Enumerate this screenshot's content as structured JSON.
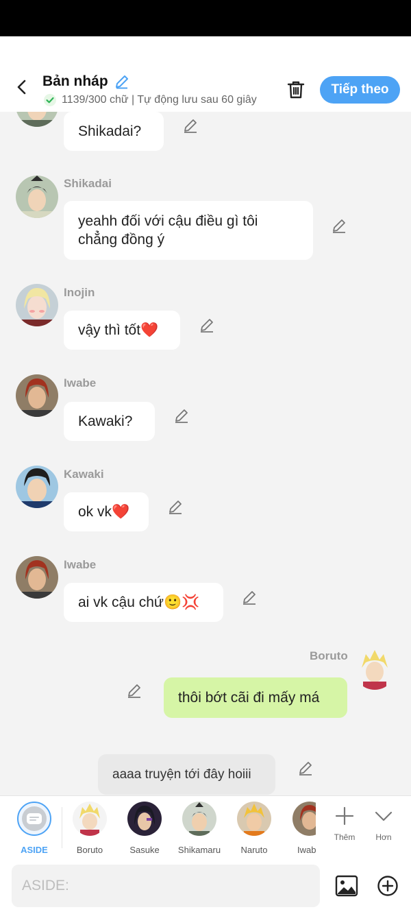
{
  "header": {
    "title": "Bản nháp",
    "status": "1139/300 chữ | Tự động lưu sau 60 giây",
    "next_label": "Tiếp theo"
  },
  "messages": [
    {
      "sender": "",
      "text": "Shikadai?"
    },
    {
      "sender": "Shikadai",
      "text": "yeahh đối với cậu điều gì tôi chẳng đồng ý"
    },
    {
      "sender": "Inojin",
      "text": "vậy thì tốt❤️"
    },
    {
      "sender": "Iwabe",
      "text": "Kawaki?"
    },
    {
      "sender": "Kawaki",
      "text": "ok vk❤️"
    },
    {
      "sender": "Iwabe",
      "text": "ai vk cậu chứ🙂💢"
    },
    {
      "sender": "Boruto",
      "text": "thôi bớt cãi đi mấy má"
    },
    {
      "sender": "",
      "text": "aaaa truyện tới đây hoiii"
    }
  ],
  "characters": [
    "ASIDE",
    "Boruto",
    "Sasuke",
    "Shikamaru",
    "Naruto",
    "Iwabe"
  ],
  "tools": {
    "add_label": "Thêm",
    "more_label": "Hơn"
  },
  "input": {
    "placeholder": "ASIDE:"
  },
  "icons": {
    "back": "chevron-left-icon",
    "edit": "pencil-icon",
    "done": "check-circle-icon",
    "delete": "trash-icon",
    "image": "image-icon",
    "add": "plus-circle-icon"
  },
  "colors": {
    "accent": "#4da3f5",
    "right_bubble": "#d6f5a6",
    "narration_bubble": "#e9e9e9"
  }
}
